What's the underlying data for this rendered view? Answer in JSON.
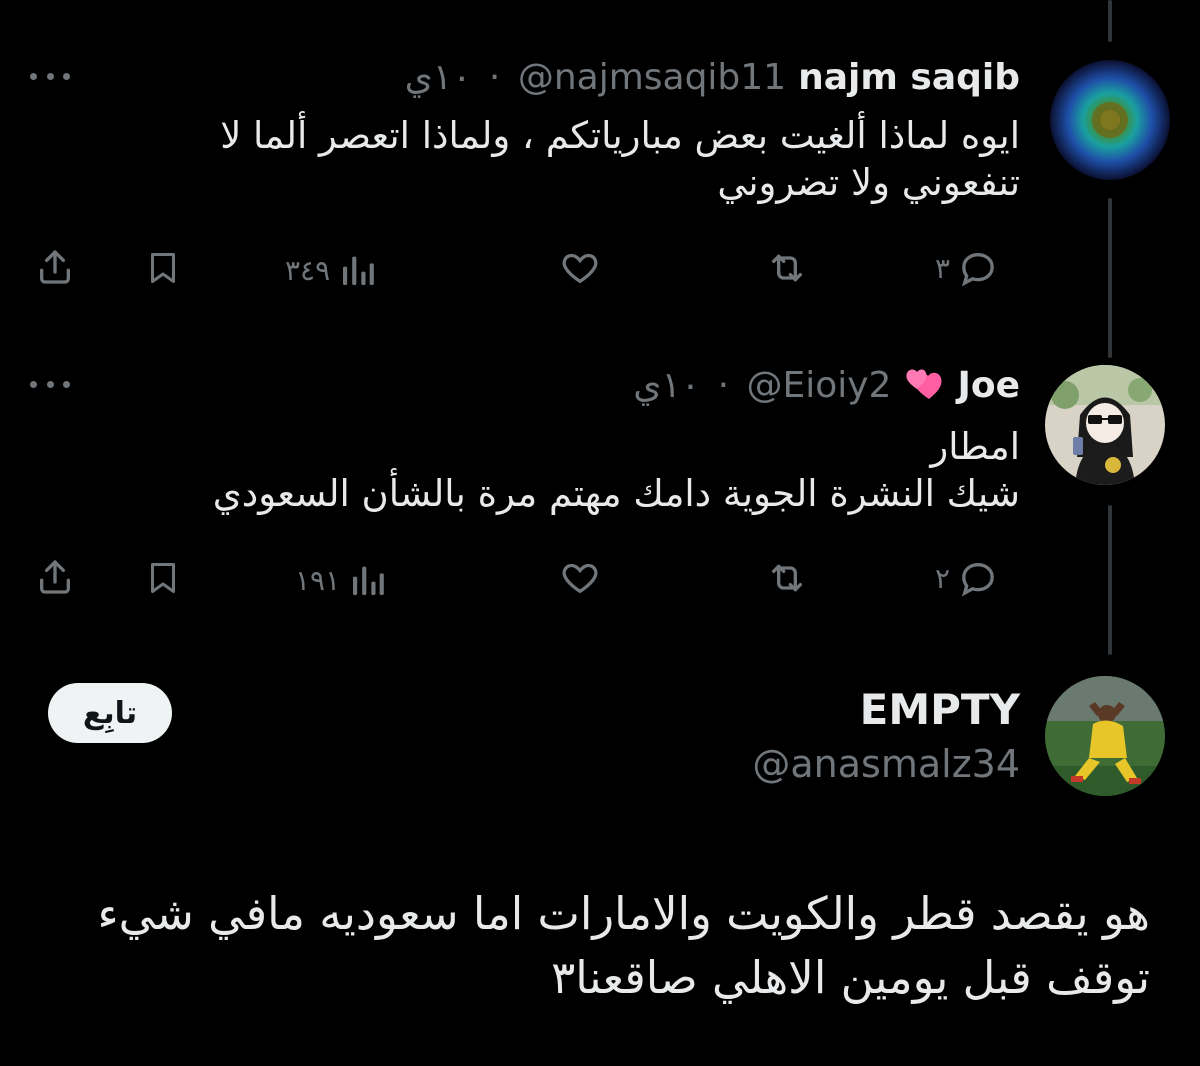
{
  "reply1": {
    "name": "najm saqib",
    "handle": "@najmsaqib11",
    "time": "١٠ي",
    "separator": "·",
    "text": "ايوه لماذا ألغيت بعض مبارياتكم ، ولماذا اتعصر ألما لا تنفعوني ولا تضروني",
    "replies": "٣",
    "views": "٣٤٩",
    "icons": [
      "more-icon",
      "reply-icon",
      "retweet-icon",
      "like-icon",
      "views-icon",
      "bookmark-icon",
      "share-icon"
    ]
  },
  "reply2": {
    "name": "Joe",
    "emoji": "💞",
    "handle": "@Eioiy2",
    "time": "١٠ي",
    "separator": "·",
    "text": "امطار\nشيك النشرة الجوية دامك مهتم مرة بالشأن السعودي",
    "replies": "٢",
    "views": "١٩١"
  },
  "main": {
    "name": "EMPTY",
    "handle": "@anasmalz34",
    "follow_label": "تابِع",
    "text": "هو يقصد قطر والكويت والامارات اما سعوديه مافي شيء توقف قبل يومين الاهلي صاقعنا٣"
  },
  "colors": {
    "background": "#000000",
    "text": "#e7e9ea",
    "muted": "#71767b",
    "thread_line": "#333639",
    "follow_bg": "#eff3f4"
  }
}
